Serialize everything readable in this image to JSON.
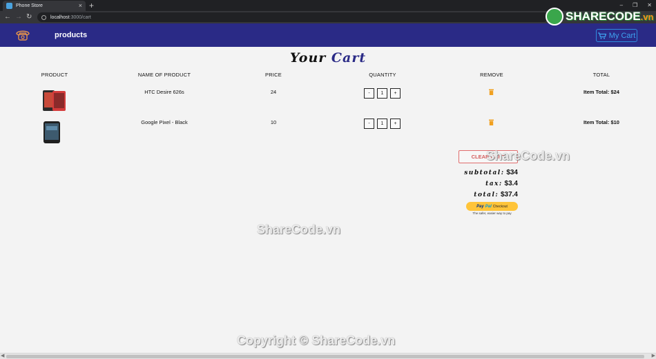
{
  "browser": {
    "tab_title": "Phone Store",
    "tab_close": "×",
    "new_tab": "+",
    "url_host": "localhost",
    "url_path": ":3000/cart",
    "back_icon": "back-arrow-icon",
    "forward_icon": "forward-arrow-icon",
    "reload_icon": "reload-icon",
    "window_controls": [
      "–",
      "❐",
      "✕"
    ]
  },
  "navbar": {
    "logo_icon": "phone-icon",
    "products_label": "products",
    "cart_label": "My Cart",
    "cart_icon": "cart-icon"
  },
  "cart": {
    "title_word1": "Your",
    "title_word2": "Cart",
    "columns": [
      "PRODUCT",
      "NAME OF PRODUCT",
      "PRICE",
      "QUANTITY",
      "REMOVE",
      "TOTAL"
    ],
    "items": [
      {
        "name": "HTC Desire 626s",
        "price": "24",
        "qty": "1",
        "dec": "-",
        "inc": "+",
        "total": "Item Total: $24"
      },
      {
        "name": "Google Pixel - Black",
        "price": "10",
        "qty": "1",
        "dec": "-",
        "inc": "+",
        "total": "Item Total: $10"
      }
    ],
    "clear_label": "CLEAR CART",
    "subtotal_label": "subtotal:",
    "subtotal_value": "$34",
    "tax_label": "tax:",
    "tax_value": "$3.4",
    "total_label": "total:",
    "total_value": "$37.4",
    "paypal_mark1": "Pay",
    "paypal_mark2": "Pal",
    "paypal_checkout": "Checkout",
    "paypal_tagline": "The safer, easier way to pay",
    "accent_color": "#2a2a86",
    "remove_color": "#f0a020"
  },
  "watermarks": {
    "logo_main": "SHARECODE",
    "logo_suffix": ".vn",
    "mark1": "ShareCode.vn",
    "mark2": "ShareCode.vn",
    "copyright": "Copyright © ShareCode.vn"
  }
}
